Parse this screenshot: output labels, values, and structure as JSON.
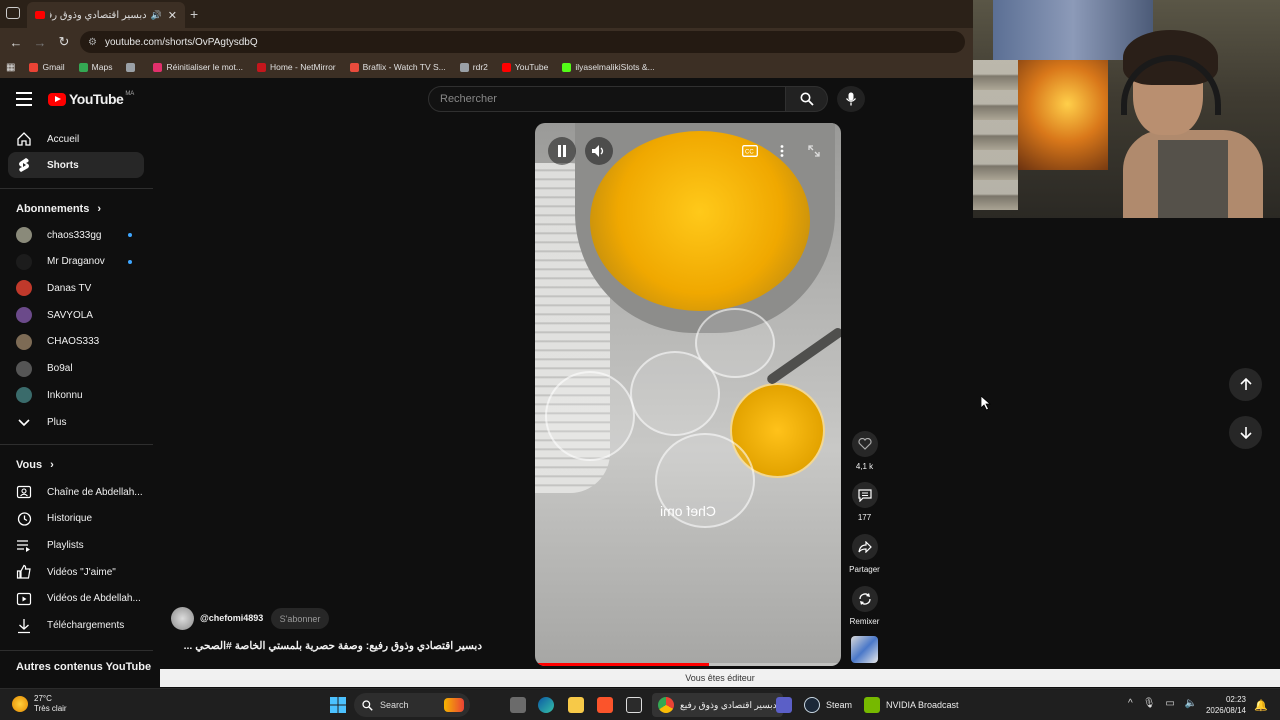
{
  "browser": {
    "tab_title": "دبسير اقتصادي وذوق رفيع",
    "url": "youtube.com/shorts/OvPAgtysdbQ",
    "bookmarks": [
      {
        "label": "Gmail",
        "color": "#ea4335"
      },
      {
        "label": "Maps",
        "color": "#34a853"
      },
      {
        "label": "",
        "color": "#9aa0a6"
      },
      {
        "label": "Réinitialiser le mot...",
        "color": "#e1306c"
      },
      {
        "label": "Home - NetMirror",
        "color": "#c4161c"
      },
      {
        "label": "Braflix - Watch TV S...",
        "color": "#e94b3c"
      },
      {
        "label": "rdr2",
        "color": "#9aa0a6"
      },
      {
        "label": "YouTube",
        "color": "#ff0000"
      },
      {
        "label": "ilyaselmalikiSlots &...",
        "color": "#53fc18"
      }
    ]
  },
  "youtube": {
    "logo_text": "YouTube",
    "country_code": "MA",
    "search_placeholder": "Rechercher"
  },
  "sidebar": {
    "main": [
      {
        "label": "Accueil",
        "icon": "home-icon"
      },
      {
        "label": "Shorts",
        "icon": "shorts-icon",
        "active": true
      }
    ],
    "subscriptions_title": "Abonnements",
    "subscriptions": [
      {
        "label": "chaos333gg",
        "color": "#8a8a7a",
        "dot": true
      },
      {
        "label": "Mr Draganov",
        "color": "#1c1c1c",
        "dot": true
      },
      {
        "label": "Danas TV",
        "color": "#c0392b",
        "dot": false
      },
      {
        "label": "SAVYOLA",
        "color": "#6b4a8a",
        "dot": false
      },
      {
        "label": "CHAOS333",
        "color": "#7d6b55",
        "dot": false
      },
      {
        "label": "Bo9al",
        "color": "#555",
        "dot": false
      },
      {
        "label": "Inkonnu",
        "color": "#3a6b6b",
        "dot": false
      }
    ],
    "more_label": "Plus",
    "you_title": "Vous",
    "you_items": [
      {
        "label": "Chaîne de Abdellah...",
        "icon": "channel-icon"
      },
      {
        "label": "Historique",
        "icon": "history-icon"
      },
      {
        "label": "Playlists",
        "icon": "playlists-icon"
      },
      {
        "label": "Vidéos \"J'aime\"",
        "icon": "thumbs-up-icon"
      },
      {
        "label": "Vidéos de Abdellah...",
        "icon": "your-videos-icon"
      },
      {
        "label": "Téléchargements",
        "icon": "download-icon"
      }
    ],
    "other_title": "Autres contenus YouTube"
  },
  "short": {
    "watermark": "Chef omi",
    "progress": 0.57,
    "likes": "4,1 k",
    "comments": "177",
    "share_label": "Partager",
    "remix_label": "Remixer",
    "channel": "@chefomi4893",
    "subscribe_label": "S'abonner",
    "title": "دبسير اقتصادي وذوق رفيع: وصفة حصرية بلمستي الخاصة #الصحي ..."
  },
  "editor_bar": "Vous êtes éditeur",
  "taskbar": {
    "weather_temp": "27°C",
    "weather_desc": "Très clair",
    "search_label": "Search",
    "apps": [
      {
        "label": "دبسير اقتصادي وذوق رفيع",
        "color": "#4285f4"
      },
      {
        "label": "Steam",
        "color": "#1b2838"
      },
      {
        "label": "NVIDIA Broadcast",
        "color": "#76b900"
      }
    ],
    "time": "02:23",
    "date": "2026/08/14"
  }
}
